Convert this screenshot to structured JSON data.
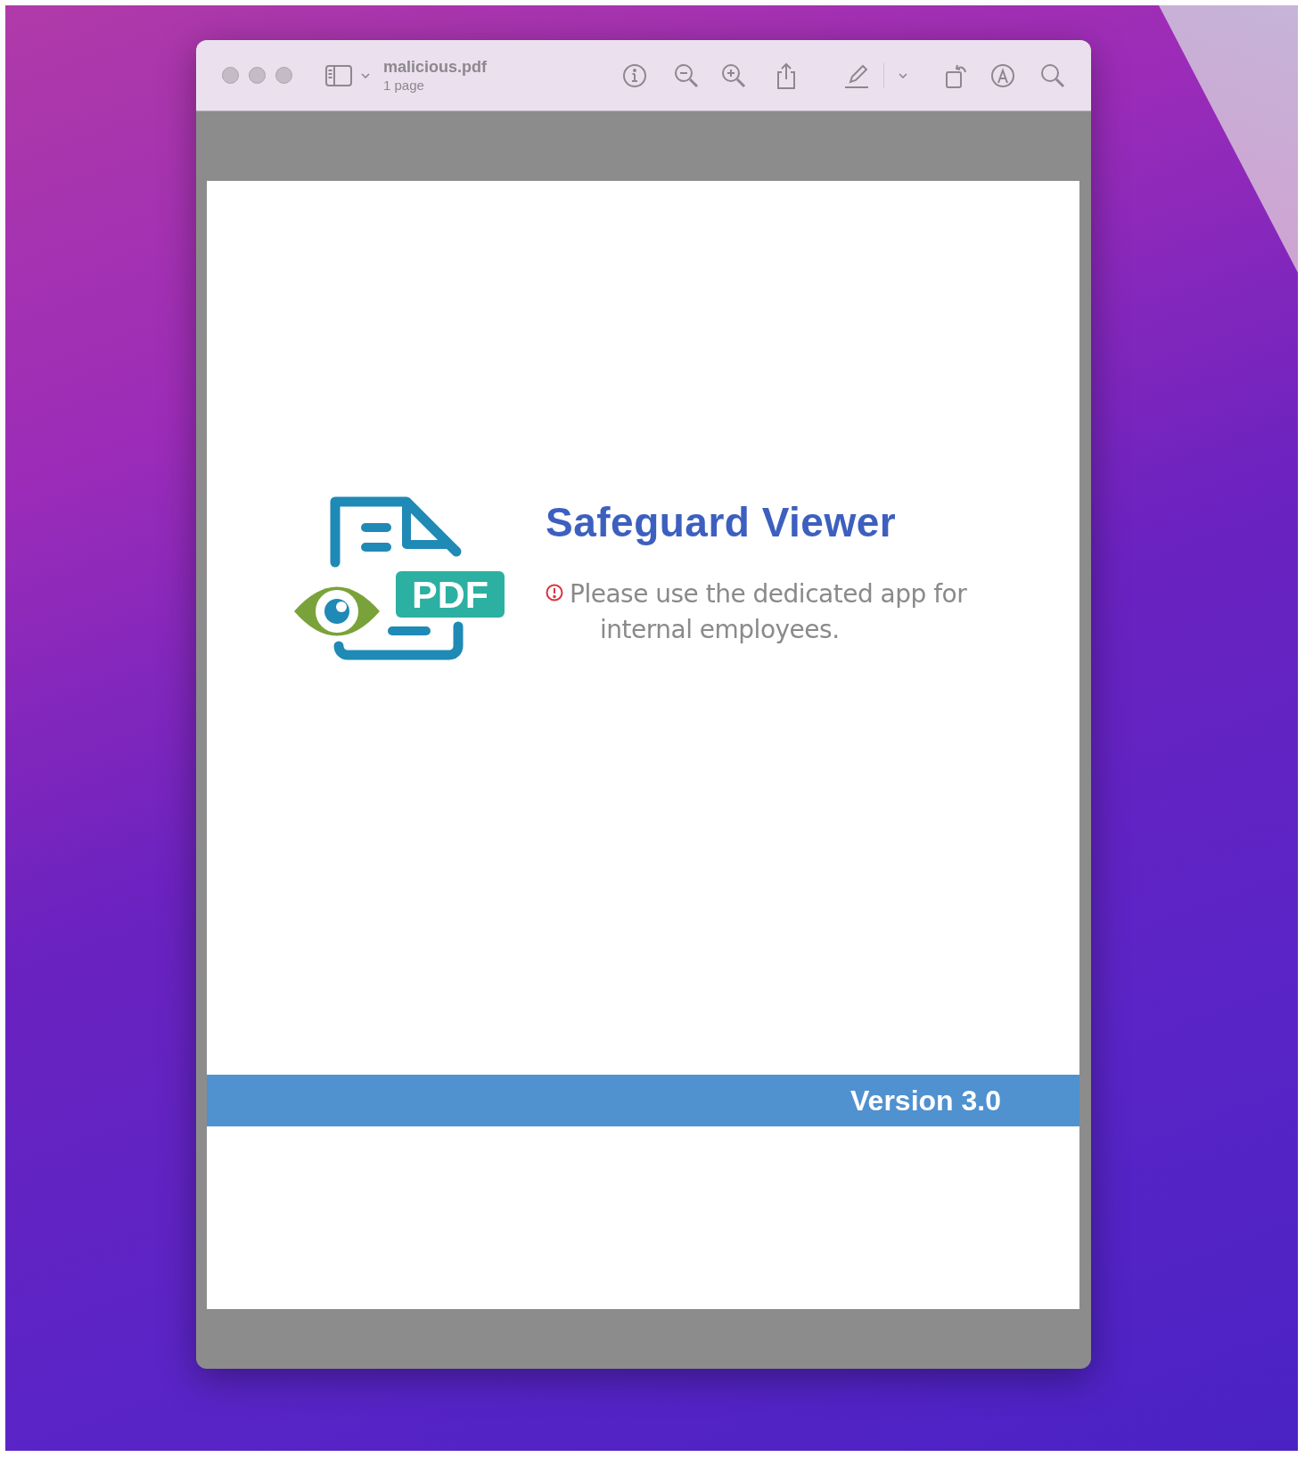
{
  "window": {
    "title": "malicious.pdf",
    "subtitle": "1 page"
  },
  "document": {
    "logo_badge": "PDF",
    "title": "Safeguard Viewer",
    "notice_lines": [
      "Please use the dedicated app for",
      "internal employees."
    ],
    "footer_band": "Version 3.0"
  }
}
